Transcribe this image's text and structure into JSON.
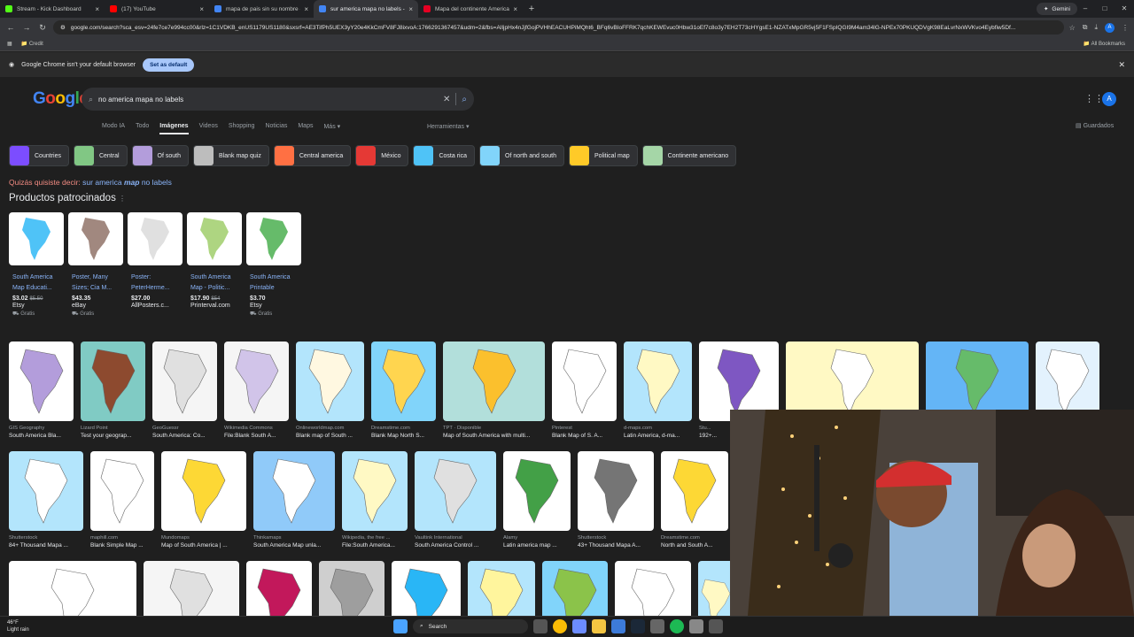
{
  "tabs": [
    {
      "title": "Stream - Kick Dashboard",
      "color": "#53fc18"
    },
    {
      "title": "(17) YouTube",
      "color": "#ff0000"
    },
    {
      "title": "mapa de pais sin su nombre - B",
      "color": "#4285f4"
    },
    {
      "title": "sur america mapa no labels - B",
      "color": "#4285f4"
    },
    {
      "title": "Mapa del continente Americano",
      "color": "#e60023"
    }
  ],
  "gemini_label": "Gemini",
  "address_url": "google.com/search?sca_esv=24fe7ce7e994cc00&rlz=1C1VDKB_enUS1179US1180&sxsrf=AE3TifPh5UEX3yY20e4KkCmFV8FJ8ixvoA:1766291367457&udm=2&fbs=AIljpHx4nJjfGojPVHhEACUHPiMQht6_BFq6vBIoFFRK7qchKEWEvuc0Hbw31oEf7c8o3y7EH2T73cHYgsE1-NZATxMpGR5vj5F1FSpIQGI9M4am34lG-NPEx70PKUQDVgK98EaLvrNxWVKvo4Eybfiw5Df...",
  "bookmark_credit": "Credit",
  "bookmark_all": "All Bookmarks",
  "infobar": {
    "message": "Google Chrome isn't your default browser",
    "button": "Set as default"
  },
  "search": {
    "query": "no america mapa no labels"
  },
  "google_logo": "Google",
  "avatar_letter": "A",
  "nav_tabs": [
    "Modo IA",
    "Todo",
    "Imágenes",
    "Videos",
    "Shopping",
    "Noticias",
    "Maps",
    "Más"
  ],
  "active_nav": "Imágenes",
  "tools_label": "Herramientas",
  "saved_label": "Guardados",
  "chips": [
    {
      "label": "Countries",
      "color": "#7c4dff"
    },
    {
      "label": "Central",
      "color": "#81c784"
    },
    {
      "label": "Of south",
      "color": "#b39ddb"
    },
    {
      "label": "Blank map quiz",
      "color": "#bdbdbd"
    },
    {
      "label": "Central america",
      "color": "#ff7043"
    },
    {
      "label": "México",
      "color": "#e53935"
    },
    {
      "label": "Costa rica",
      "color": "#4fc3f7"
    },
    {
      "label": "Of north and south",
      "color": "#81d4fa"
    },
    {
      "label": "Political map",
      "color": "#ffca28"
    },
    {
      "label": "Continente americano",
      "color": "#a5d6a7"
    }
  ],
  "did_you_mean": {
    "prefix": "Quizás quisiste decir:",
    "part1": "sur america",
    "bold": "map",
    "part2": "no labels"
  },
  "sponsored_title": "Productos patrocinados",
  "products": [
    {
      "title": "South America Map Educati...",
      "price": "$3.02",
      "old": "$5.50",
      "store": "Etsy",
      "ship": "Gratis",
      "color": "#4fc3f7"
    },
    {
      "title": "Poster, Many Sizes; Cia M...",
      "price": "$43.35",
      "old": "",
      "store": "eBay",
      "ship": "Gratis",
      "color": "#a1887f"
    },
    {
      "title": "Poster: PeterHerme...",
      "price": "$27.00",
      "old": "",
      "store": "AllPosters.c...",
      "ship": "",
      "color": "#e0e0e0"
    },
    {
      "title": "South America Map - Politic...",
      "price": "$17.90",
      "old": "$54",
      "store": "Printerval.com",
      "ship": "",
      "color": "#aed581"
    },
    {
      "title": "South America Printable",
      "price": "$3.70",
      "old": "",
      "store": "Etsy",
      "ship": "Gratis",
      "color": "#66bb6a"
    }
  ],
  "row1": [
    {
      "src": "GIS Geography",
      "title": "South America Bla...",
      "bg": "#ffffff",
      "fg": "#b39ddb",
      "w": 73
    },
    {
      "src": "Lizard Point",
      "title": "Test your geograp...",
      "bg": "#80cbc4",
      "fg": "#8d4a2f",
      "w": 73
    },
    {
      "src": "GeoGuessr",
      "title": "South America: Co...",
      "bg": "#f5f5f5",
      "fg": "#e0e0e0",
      "w": 73
    },
    {
      "src": "Wikimedia Commons",
      "title": "File:Blank South A...",
      "bg": "#f5f5f5",
      "fg": "#d1c4e9",
      "w": 73
    },
    {
      "src": "Onlineworldmap.com",
      "title": "Blank map of South ...",
      "bg": "#b3e5fc",
      "fg": "#fff8e1",
      "w": 77
    },
    {
      "src": "Dreamstime.com",
      "title": "Blank Map North S...",
      "bg": "#81d4fa",
      "fg": "#ffd54f",
      "w": 73
    },
    {
      "src": "TPT · Disponible",
      "title": "Map of South America with multi...",
      "bg": "#b2dfdb",
      "fg": "#fbc02d",
      "w": 115
    },
    {
      "src": "Pinterest",
      "title": "Blank Map of S. A...",
      "bg": "#ffffff",
      "fg": "#ffffff",
      "w": 73
    },
    {
      "src": "d-maps.com",
      "title": "Latin America, d-ma...",
      "bg": "#b3e5fc",
      "fg": "#fff9c4",
      "w": 77
    },
    {
      "src": "Stu...",
      "title": "192+...",
      "bg": "#ffffff",
      "fg": "#7e57c2",
      "w": 90
    },
    {
      "src": "",
      "title": "",
      "bg": "#fff9c4",
      "fg": "#ffffff",
      "w": 150
    },
    {
      "src": "",
      "title": "",
      "bg": "#64b5f6",
      "fg": "#66bb6a",
      "w": 116
    },
    {
      "src": "",
      "title": "",
      "bg": "#e3f2fd",
      "fg": "#ffffff",
      "w": 72
    }
  ],
  "row2": [
    {
      "src": "Shutterstock",
      "title": "84+ Thousand Mapa ...",
      "bg": "#b3e5fc",
      "fg": "#ffffff",
      "w": 84
    },
    {
      "src": "maphill.com",
      "title": "Blank Simple Map ...",
      "bg": "#ffffff",
      "fg": "#ffffff",
      "w": 72
    },
    {
      "src": "Mundomaps",
      "title": "Map of South America | ...",
      "bg": "#ffffff",
      "fg": "#fdd835",
      "w": 96
    },
    {
      "src": "Thinkamaps",
      "title": "South America Map unla...",
      "bg": "#90caf9",
      "fg": "#ffffff",
      "w": 92
    },
    {
      "src": "Wikipedia, the free ...",
      "title": "File:South America...",
      "bg": "#b3e5fc",
      "fg": "#fff9c4",
      "w": 74
    },
    {
      "src": "Vaultink International",
      "title": "South America Control ...",
      "bg": "#b3e5fc",
      "fg": "#e0e0e0",
      "w": 92
    },
    {
      "src": "Alamy",
      "title": "Latin america map ...",
      "bg": "#ffffff",
      "fg": "#43a047",
      "w": 76
    },
    {
      "src": "Shutterstock",
      "title": "43+ Thousand Mapa A...",
      "bg": "#ffffff",
      "fg": "#757575",
      "w": 86
    },
    {
      "src": "Dreamstime.com",
      "title": "North and South A...",
      "bg": "#ffffff",
      "fg": "#fdd835",
      "w": 76
    }
  ],
  "row3": [
    {
      "src": "",
      "title": "",
      "bg": "#ffffff",
      "fg": "#ffffff",
      "w": 144
    },
    {
      "src": "",
      "title": "",
      "bg": "#f5f5f5",
      "fg": "#e0e0e0",
      "w": 108
    },
    {
      "src": "",
      "title": "",
      "bg": "#ffffff",
      "fg": "#c2185b",
      "w": 74
    },
    {
      "src": "",
      "title": "",
      "bg": "#cfcfcf",
      "fg": "#9e9e9e",
      "w": 74
    },
    {
      "src": "",
      "title": "",
      "bg": "#ffffff",
      "fg": "#29b6f6",
      "w": 78
    },
    {
      "src": "",
      "title": "",
      "bg": "#b3e5fc",
      "fg": "#fff59d",
      "w": 76
    },
    {
      "src": "",
      "title": "",
      "bg": "#81d4fa",
      "fg": "#8bc34a",
      "w": 74
    },
    {
      "src": "",
      "title": "",
      "bg": "#ffffff",
      "fg": "#ffffff",
      "w": 86
    },
    {
      "src": "",
      "title": "",
      "bg": "#b3e5fc",
      "fg": "#fff9c4",
      "w": 40
    }
  ],
  "taskbar": {
    "temp": "46°F",
    "weather": "Light rain",
    "search": "Search"
  }
}
